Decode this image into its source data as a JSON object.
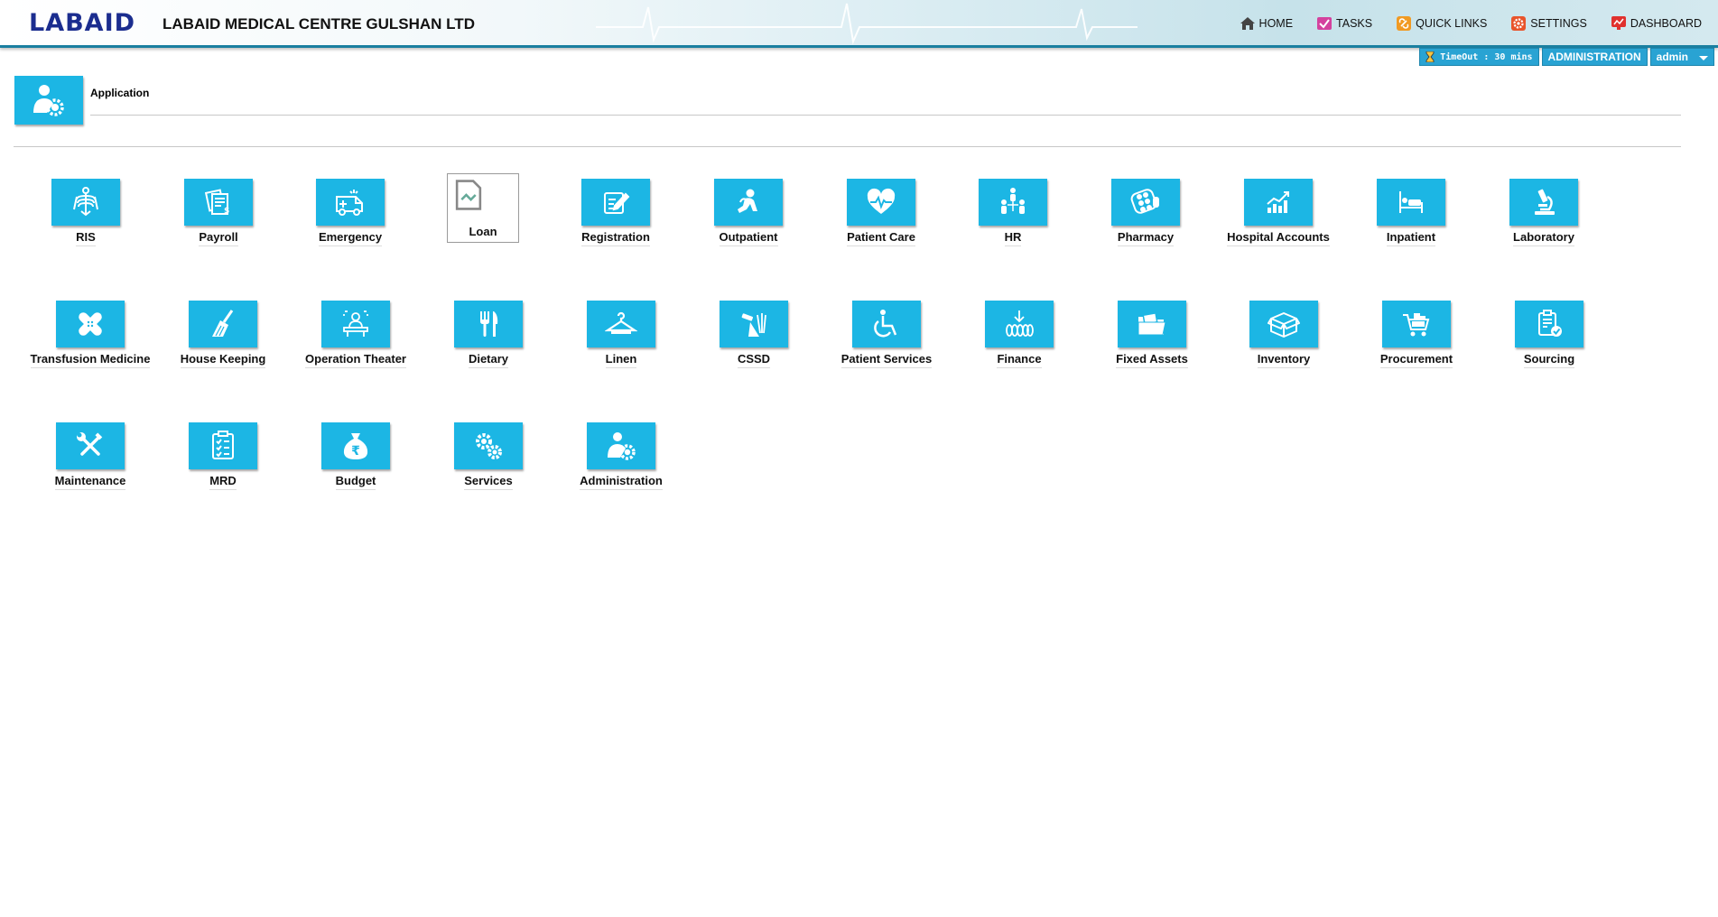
{
  "header": {
    "logo": "LABAID",
    "org_name": "LABAID MEDICAL CENTRE GULSHAN LTD",
    "nav": [
      {
        "label": "HOME",
        "icon": "home-icon"
      },
      {
        "label": "TASKS",
        "icon": "tasks-icon"
      },
      {
        "label": "QUICK LINKS",
        "icon": "link-icon"
      },
      {
        "label": "SETTINGS",
        "icon": "gear-icon"
      },
      {
        "label": "DASHBOARD",
        "icon": "dashboard-icon"
      }
    ]
  },
  "statusbar": {
    "timeout": "TimeOut : 30 mins",
    "module": "ADMINISTRATION",
    "user": "admin"
  },
  "page": {
    "title": "Application"
  },
  "colors": {
    "tile": "#1cb6e4",
    "header_border": "#1a7fa0",
    "status_bg": "#29a3d3",
    "logo": "#1b2d8f"
  },
  "modules": [
    {
      "label": "RIS",
      "icon": "skeleton-icon"
    },
    {
      "label": "Payroll",
      "icon": "payroll-icon"
    },
    {
      "label": "Emergency",
      "icon": "ambulance-icon"
    },
    {
      "label": "Loan",
      "icon": "broken-image-icon"
    },
    {
      "label": "Registration",
      "icon": "register-pen-icon"
    },
    {
      "label": "Outpatient",
      "icon": "outpatient-icon"
    },
    {
      "label": "Patient Care",
      "icon": "heart-pulse-icon"
    },
    {
      "label": "HR",
      "icon": "people-icon"
    },
    {
      "label": "Pharmacy",
      "icon": "pills-icon"
    },
    {
      "label": "Hospital Accounts",
      "icon": "chart-up-icon"
    },
    {
      "label": "Inpatient",
      "icon": "bed-icon"
    },
    {
      "label": "Laboratory",
      "icon": "microscope-icon"
    },
    {
      "label": "Transfusion Medicine",
      "icon": "bandage-icon"
    },
    {
      "label": "House Keeping",
      "icon": "broom-icon"
    },
    {
      "label": "Operation Theater",
      "icon": "surgery-icon"
    },
    {
      "label": "Dietary",
      "icon": "fork-knife-icon"
    },
    {
      "label": "Linen",
      "icon": "hanger-icon"
    },
    {
      "label": "CSSD",
      "icon": "sterile-tools-icon"
    },
    {
      "label": "Patient Services",
      "icon": "wheelchair-icon"
    },
    {
      "label": "Finance",
      "icon": "coins-icon"
    },
    {
      "label": "Fixed Assets",
      "icon": "folder-icon"
    },
    {
      "label": "Inventory",
      "icon": "box-icon"
    },
    {
      "label": "Procurement",
      "icon": "cart-icon"
    },
    {
      "label": "Sourcing",
      "icon": "clipboard-check-icon"
    },
    {
      "label": "Maintenance",
      "icon": "wrench-screwdriver-icon"
    },
    {
      "label": "MRD",
      "icon": "checklist-icon"
    },
    {
      "label": "Budget",
      "icon": "money-bag-icon"
    },
    {
      "label": "Services",
      "icon": "gears-icon"
    },
    {
      "label": "Administration",
      "icon": "admin-gear-icon"
    }
  ]
}
